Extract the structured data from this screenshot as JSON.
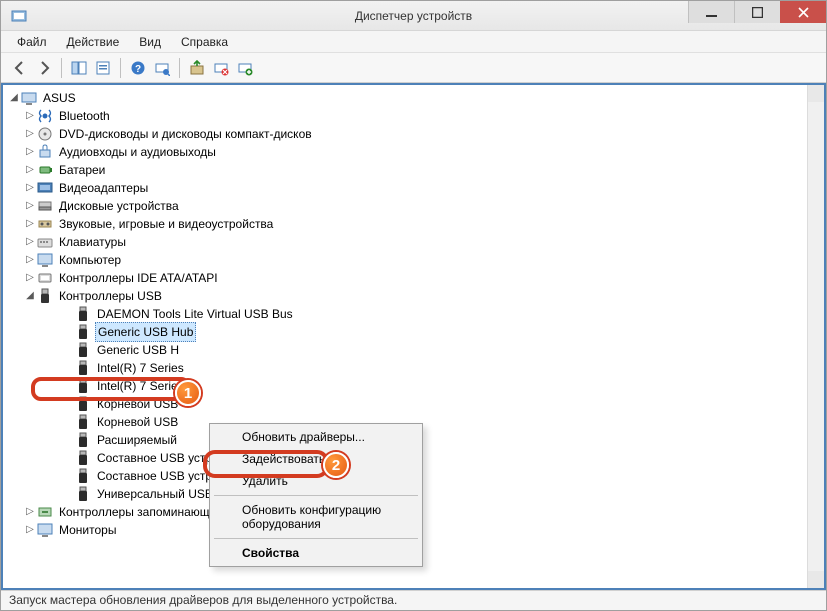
{
  "window": {
    "title": "Диспетчер устройств"
  },
  "menu": {
    "file": "Файл",
    "action": "Действие",
    "view": "Вид",
    "help": "Справка"
  },
  "tree": {
    "root": "ASUS",
    "items": [
      "Bluetooth",
      "DVD-дисководы и дисководы компакт-дисков",
      "Аудиовходы и аудиовыходы",
      "Батареи",
      "Видеоадаптеры",
      "Дисковые устройства",
      "Звуковые, игровые и видеоустройства",
      "Клавиатуры",
      "Компьютер",
      "Контроллеры IDE ATA/ATAPI"
    ],
    "usb_controllers_label": "Контроллеры USB",
    "usb_children": [
      "DAEMON Tools Lite Virtual USB Bus",
      "Generic USB Hub",
      "Generic USB H",
      "Intel(R) 7 Series",
      "Intel(R) 7 Series",
      "Корневой USB",
      "Корневой USB",
      "Расширяемый",
      "Составное USB устройство",
      "Составное USB устройство",
      "Универсальный USB-концентратор"
    ],
    "tail": [
      "Контроллеры запоминающих устройств",
      "Мониторы"
    ]
  },
  "context_menu": {
    "update": "Обновить драйверы...",
    "enable": "Задействовать",
    "delete": "Удалить",
    "refresh": "Обновить конфигурацию оборудования",
    "properties": "Свойства"
  },
  "annotations": {
    "badge1": "1",
    "badge2": "2"
  },
  "statusbar": {
    "text": "Запуск мастера обновления драйверов для выделенного устройства."
  }
}
